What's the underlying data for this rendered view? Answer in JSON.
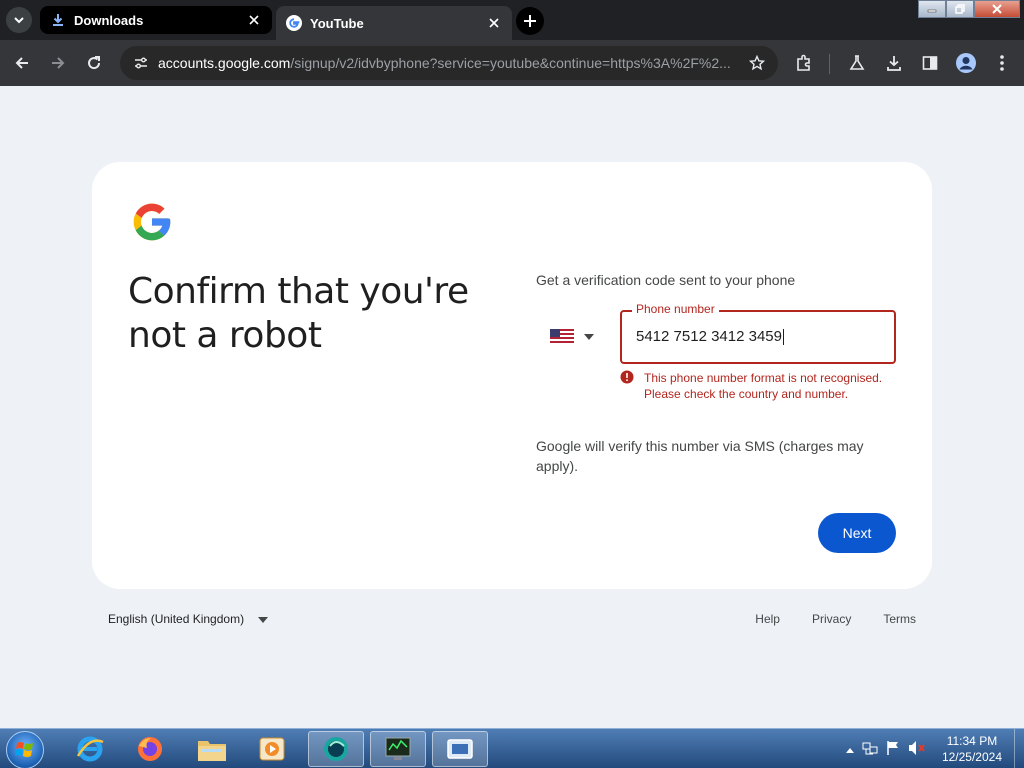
{
  "browser": {
    "tabs": [
      {
        "title": "Downloads",
        "icon": "download-icon",
        "active": false
      },
      {
        "title": "YouTube",
        "icon": "google-favicon",
        "active": true
      }
    ],
    "url_host": "accounts.google.com",
    "url_path": "/signup/v2/idvbyphone?service=youtube&continue=https%3A%2F%2..."
  },
  "page": {
    "heading": "Confirm that you're not a robot",
    "prompt": "Get a verification code sent to your phone",
    "country_selected": "US",
    "phone_label": "Phone number",
    "phone_value": "5412 7512 3412 3459",
    "error_text": "This phone number format is not recognised. Please check the country and number.",
    "sms_note": "Google will verify this number via SMS (charges may apply).",
    "next_label": "Next",
    "error_color": "#b3261e",
    "accent_color": "#0b57d0"
  },
  "footer": {
    "language": "English (United Kingdom)",
    "links": [
      "Help",
      "Privacy",
      "Terms"
    ]
  },
  "taskbar": {
    "time": "11:34 PM",
    "date": "12/25/2024"
  }
}
